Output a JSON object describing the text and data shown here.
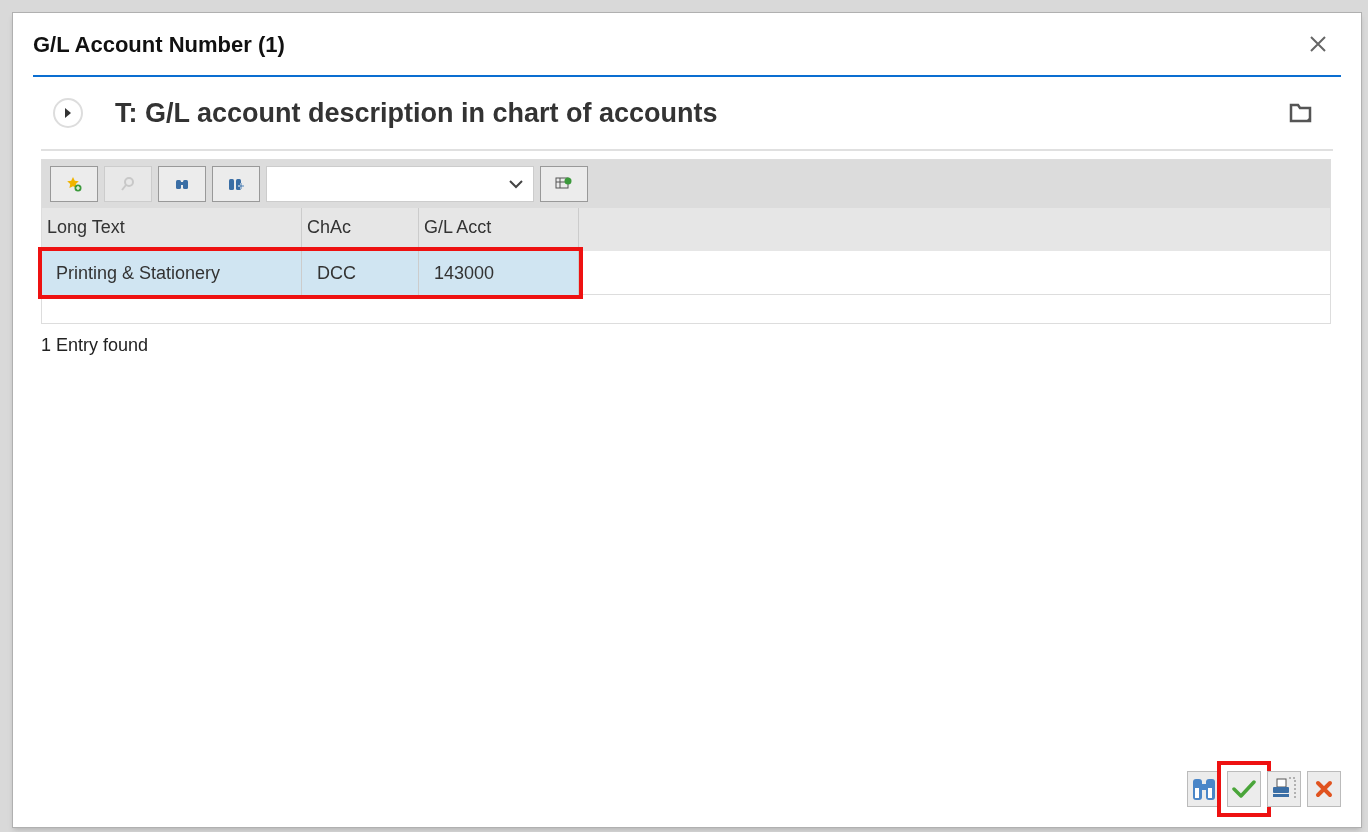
{
  "dialog": {
    "title": "G/L Account Number (1)",
    "heading": "T: G/L account description in chart of accounts"
  },
  "toolbar": {
    "buttons": [
      {
        "kind": "add-favorite",
        "disabled": false
      },
      {
        "kind": "details",
        "disabled": true
      },
      {
        "kind": "find",
        "disabled": false
      },
      {
        "kind": "find-next",
        "disabled": false
      }
    ],
    "select": {
      "open": false
    }
  },
  "table": {
    "columns": [
      "Long Text",
      "ChAc",
      "G/L Acct"
    ],
    "rows": [
      {
        "cells": [
          "Printing & Stationery",
          "DCC",
          "143000"
        ],
        "selected": true,
        "highlighted": true
      }
    ]
  },
  "status": "1 Entry found",
  "footer_buttons": [
    {
      "kind": "search",
      "highlighted": false
    },
    {
      "kind": "confirm",
      "highlighted": true
    },
    {
      "kind": "print",
      "highlighted": false
    },
    {
      "kind": "cancel",
      "highlighted": false
    }
  ]
}
